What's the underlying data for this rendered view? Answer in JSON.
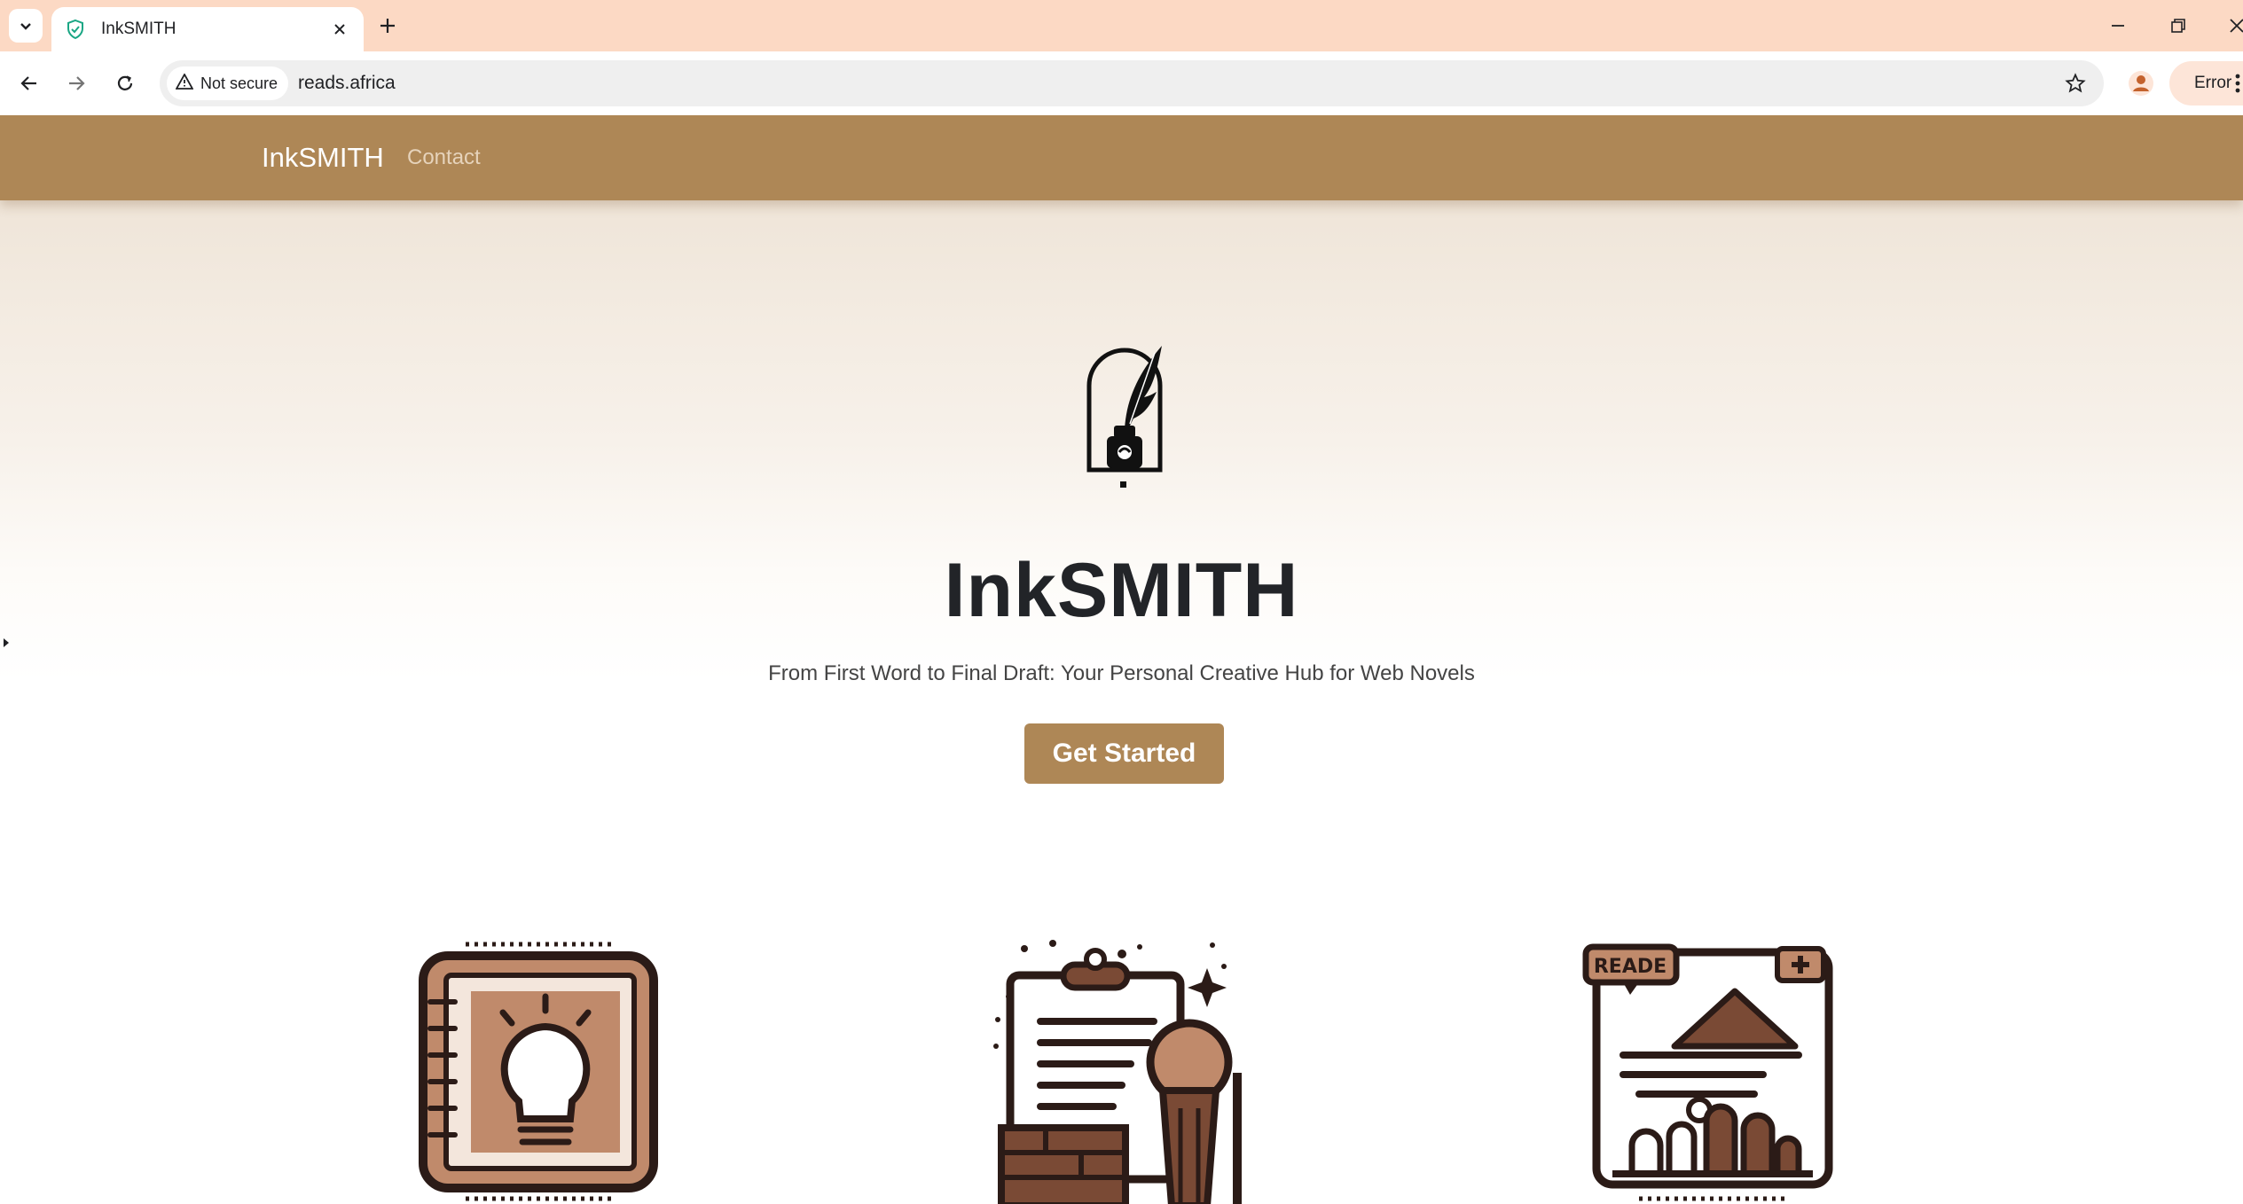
{
  "browser": {
    "tab_title": "InkSMITH",
    "security_label": "Not secure",
    "url": "reads.africa",
    "profile_status": "Error"
  },
  "site": {
    "brand": "InkSMITH",
    "nav_links": [
      "Contact"
    ]
  },
  "hero": {
    "title": "InkSMITH",
    "subtitle": "From First Word to Final Draft: Your Personal Creative Hub for Web Novels",
    "cta_label": "Get Started"
  },
  "features": {
    "card3_badge": "READE"
  },
  "colors": {
    "accent": "#ae8756",
    "tabbar": "#fcd9c4",
    "icon_dark": "#2b1b17",
    "icon_brown": "#7a4a35",
    "icon_light": "#c08a6b"
  },
  "icons": [
    "tab-search-icon",
    "shield-check-icon",
    "close-icon",
    "plus-icon",
    "minimize-icon",
    "restore-icon",
    "back-icon",
    "forward-icon",
    "reload-icon",
    "warning-icon",
    "star-icon",
    "profile-icon",
    "kebab-icon",
    "quill-inkwell-icon",
    "lightbulb-notebook-icon",
    "clipboard-manuscript-icon",
    "reader-analytics-icon"
  ]
}
